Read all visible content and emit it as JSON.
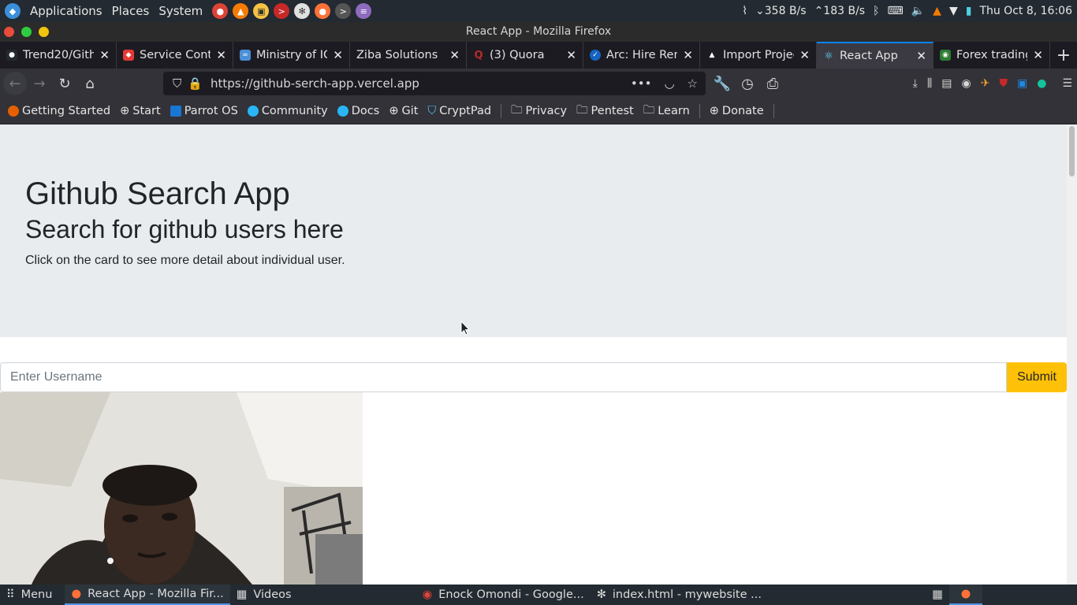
{
  "system": {
    "applications": "Applications",
    "places": "Places",
    "system": "System",
    "net_down": "358 B/s",
    "net_up": "183 B/s",
    "clock": "Thu Oct 8, 16:06"
  },
  "window": {
    "title": "React App - Mozilla Firefox"
  },
  "tabs": [
    {
      "label": "Trend20/Gith",
      "color": "#24292e"
    },
    {
      "label": "Service Conta",
      "color": "#e53935"
    },
    {
      "label": "Ministry of IC",
      "color": "#4a90d9"
    },
    {
      "label": "Ziba Solutions",
      "color": "#1c1b22"
    },
    {
      "label": "(3) Quora",
      "color": "#b92b27"
    },
    {
      "label": "Arc: Hire Rem",
      "color": "#1565c0"
    },
    {
      "label": "Import Projec",
      "color": "#000000"
    },
    {
      "label": "React App",
      "color": "#61dafb"
    },
    {
      "label": "Forex trading",
      "color": "#2e7d32"
    }
  ],
  "url": "https://github-serch-app.vercel.app",
  "bookmarks": [
    {
      "label": "Getting Started",
      "color": "#e66000"
    },
    {
      "label": "Start",
      "color": "#9e9e9e"
    },
    {
      "label": "Parrot OS",
      "color": "#1976d2"
    },
    {
      "label": "Community",
      "color": "#29b6f6"
    },
    {
      "label": "Docs",
      "color": "#29b6f6"
    },
    {
      "label": "Git",
      "color": "#9e9e9e"
    },
    {
      "label": "CryptPad",
      "color": "#4fc3f7"
    },
    {
      "label": "Privacy",
      "color": "#9e9e9e"
    },
    {
      "label": "Pentest",
      "color": "#9e9e9e"
    },
    {
      "label": "Learn",
      "color": "#9e9e9e"
    },
    {
      "label": "Donate",
      "color": "#9e9e9e"
    }
  ],
  "page": {
    "title": "Github Search App",
    "subtitle": "Search for github users here",
    "description": "Click on the card to see more detail about individual user.",
    "search_placeholder": "Enter Username",
    "submit_label": "Submit"
  },
  "taskbar": {
    "menu": "Menu",
    "items": [
      {
        "label": "React App - Mozilla Fir..."
      },
      {
        "label": "Videos"
      },
      {
        "label": "Enock Omondi - Google..."
      },
      {
        "label": "index.html - mywebsite ..."
      }
    ]
  }
}
